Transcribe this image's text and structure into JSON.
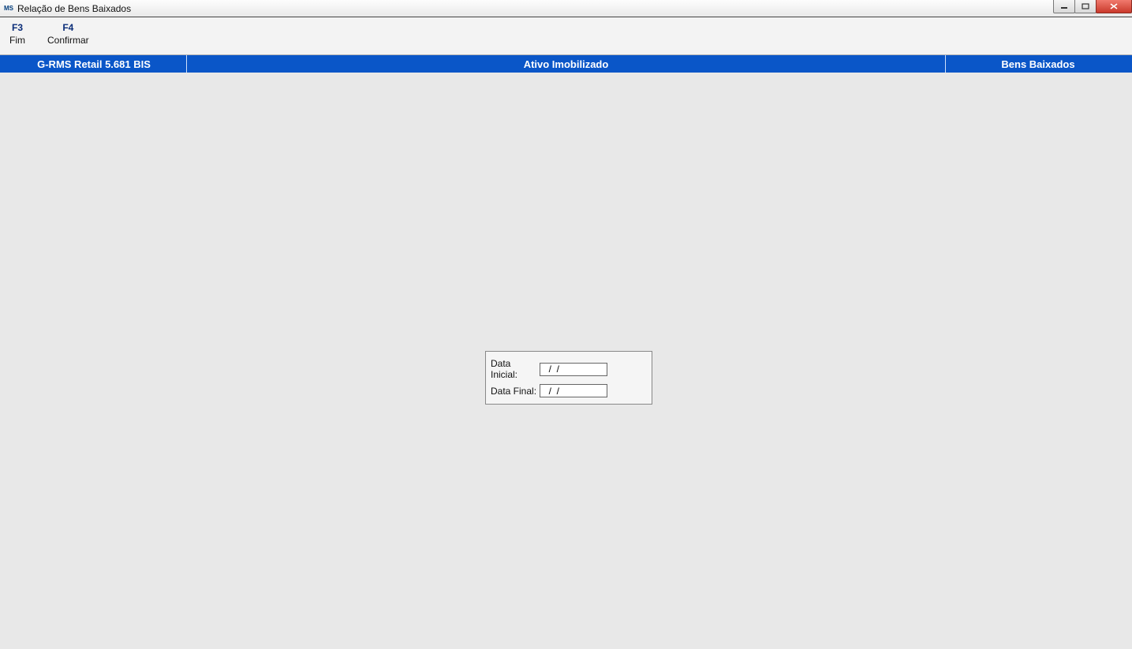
{
  "window": {
    "icon_text": "MS",
    "title": "Relação de Bens Baixados"
  },
  "menu": {
    "items": [
      {
        "fkey": "F3",
        "label": "Fim"
      },
      {
        "fkey": "F4",
        "label": "Confirmar"
      }
    ]
  },
  "header": {
    "left": "G-RMS Retail 5.681 BIS",
    "center": "Ativo Imobilizado",
    "right": "Bens Baixados"
  },
  "form": {
    "data_inicial_label": "Data Inicial:",
    "data_inicial_value": "  /  /",
    "data_final_label": "Data Final:",
    "data_final_value": "  /  /"
  }
}
